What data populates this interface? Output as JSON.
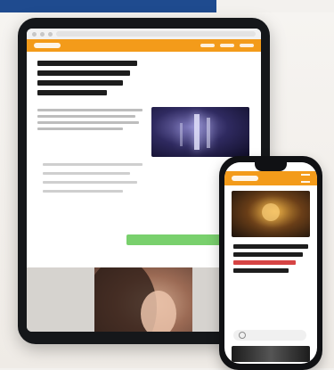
{
  "scene": {
    "title": "",
    "colors": {
      "brand_orange": "#f39b1a",
      "accent_green": "#79d06d",
      "navy": "#1f4b8f"
    },
    "devices": [
      "tablet",
      "phone"
    ]
  }
}
